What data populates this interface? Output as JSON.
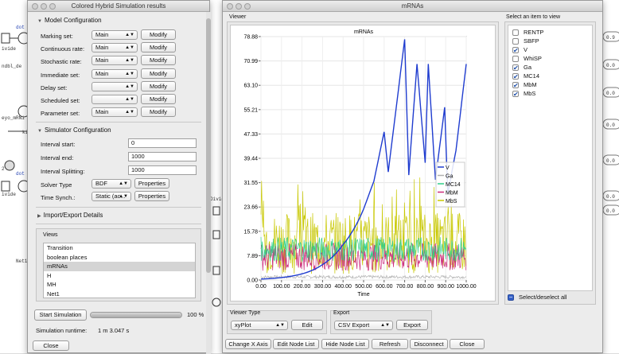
{
  "left_window": {
    "title": "Colored Hybrid Simulation results",
    "model_config": {
      "header": "Model Configuration",
      "rows": [
        {
          "label": "Marking set:",
          "value": "Main",
          "button": "Modify"
        },
        {
          "label": "Continuous rate:",
          "value": "Main",
          "button": "Modify"
        },
        {
          "label": "Stochastic  rate:",
          "value": "Main",
          "button": "Modify"
        },
        {
          "label": "Immediate set:",
          "value": "Main",
          "button": "Modify"
        },
        {
          "label": "Delay set:",
          "value": "",
          "button": "Modify"
        },
        {
          "label": "Scheduled set:",
          "value": "",
          "button": "Modify"
        },
        {
          "label": "Parameter set:",
          "value": "Main",
          "button": "Modify"
        }
      ]
    },
    "sim_config": {
      "header": "Simulator Configuration",
      "interval_start_label": "Interval start:",
      "interval_start": "0",
      "interval_end_label": "Interval end:",
      "interval_end": "1000",
      "interval_split_label": "Interval Splitting:",
      "interval_split": "1000",
      "solver_label": "Solver Type",
      "solver": "BDF",
      "solver_btn": "Properties",
      "timesync_label": "Time Synch.:",
      "timesync": "Static (ac...",
      "timesync_btn": "Properties"
    },
    "import_export": "Import/Export Details",
    "views": {
      "label": "Views",
      "items": [
        "Transition",
        "boolean places",
        "mRNAs",
        "H",
        "MH",
        "Net1"
      ],
      "selected": 2
    },
    "start_btn": "Start Simulation",
    "progress_pct": "100 %",
    "progress": 1.0,
    "runtime_label": "Simulation runtime:",
    "runtime": "1 m 3.047 s",
    "close": "Close"
  },
  "right_window": {
    "title": "mRNAs",
    "viewer_label": "Viewer",
    "select_label": "Select an item to view",
    "items": [
      {
        "name": "RENTP",
        "checked": false
      },
      {
        "name": "SBFP",
        "checked": false
      },
      {
        "name": "V",
        "checked": true
      },
      {
        "name": "WhiSP",
        "checked": false
      },
      {
        "name": "Ga",
        "checked": true
      },
      {
        "name": "MC14",
        "checked": true
      },
      {
        "name": "MbM",
        "checked": true
      },
      {
        "name": "MbS",
        "checked": true
      }
    ],
    "select_all": "Select/deselect all",
    "viewer_type_label": "Viewer Type",
    "viewer_type": "xyPlot",
    "edit_btn": "Edit",
    "export_label": "Export",
    "export_type": "CSV Export",
    "export_btn": "Export",
    "bottom_buttons": [
      "Change X Axis",
      "Edit Node List",
      "Hide Node List",
      "Refresh",
      "Disconnect",
      "Close"
    ]
  },
  "background": {
    "labels": [
      "dot",
      "ivide",
      "ndbl_de",
      "eyo_mRNi",
      "ki",
      "2",
      "dot",
      "ivide",
      "Divide",
      "Net1_c",
      "0.9",
      "0.0",
      "0.0",
      "0.0",
      "0.0",
      "0.0",
      "0.0"
    ]
  },
  "chart_data": {
    "type": "line",
    "title": "mRNAs",
    "xlabel": "Time",
    "ylabel": "",
    "xlim": [
      0,
      1000
    ],
    "ylim": [
      0,
      78.88
    ],
    "xticks": [
      "0.00",
      "100.00",
      "200.00",
      "300.00",
      "400.00",
      "500.00",
      "600.00",
      "700.00",
      "800.00",
      "900.00",
      "1000.00"
    ],
    "yticks": [
      "0.00",
      "7.89",
      "15.78",
      "23.66",
      "31.55",
      "39.44",
      "47.33",
      "55.21",
      "63.10",
      "70.99",
      "78.88"
    ],
    "legend": [
      "V",
      "Ga",
      "MC14",
      "MbM",
      "MbS"
    ],
    "colors": {
      "V": "#1f3ccf",
      "Ga": "#b0b0b0",
      "MC14": "#2fcf8a",
      "MbM": "#cc2a7a",
      "MbS": "#c8c800"
    },
    "series": [
      {
        "name": "V",
        "x": [
          0,
          100,
          200,
          300,
          400,
          500,
          550,
          600,
          620,
          700,
          720,
          760,
          800,
          815,
          850,
          895,
          910,
          950,
          1000
        ],
        "y": [
          0.3,
          0.8,
          2.0,
          5.0,
          11.5,
          23.0,
          32.0,
          48.0,
          35.0,
          78.0,
          34.0,
          70.0,
          38.0,
          70.0,
          32.5,
          56.0,
          28.0,
          42.0,
          70.0
        ]
      },
      {
        "name": "Ga",
        "band": [
          0.5,
          1.5
        ]
      },
      {
        "name": "MC14",
        "band": [
          6,
          14
        ]
      },
      {
        "name": "MbM",
        "band": [
          3,
          12
        ]
      },
      {
        "name": "MbS",
        "band": [
          2,
          22
        ]
      }
    ]
  }
}
